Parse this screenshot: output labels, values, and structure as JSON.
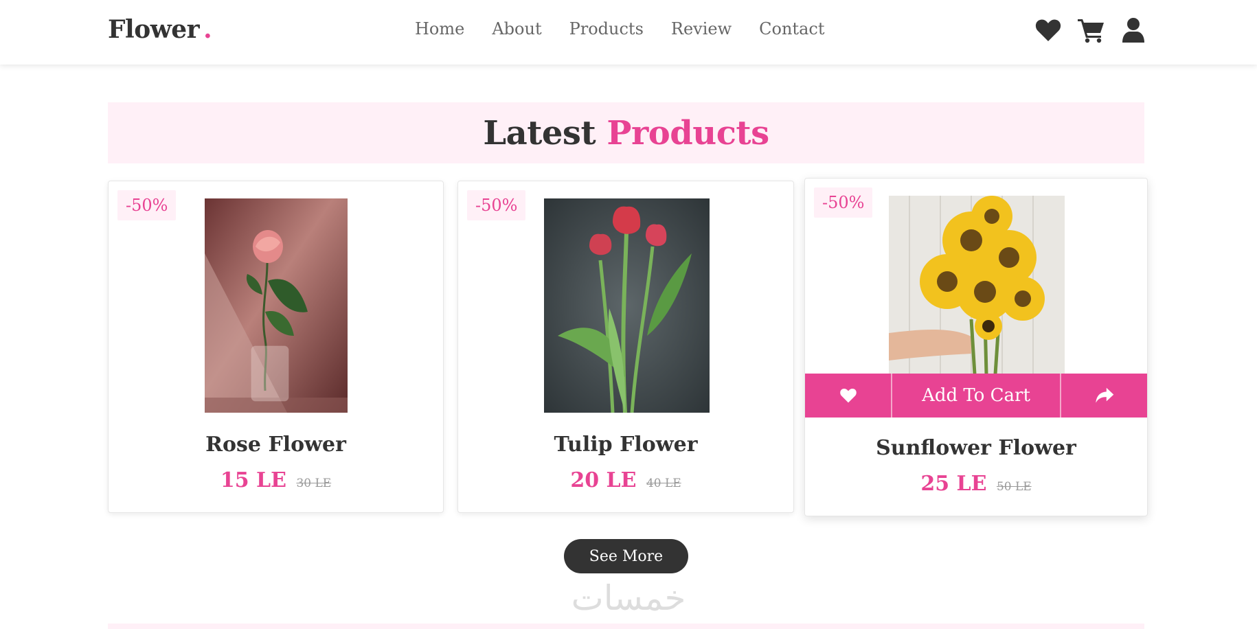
{
  "header": {
    "logo_text": "Flower",
    "logo_dot": ".",
    "nav": [
      "Home",
      "About",
      "Products",
      "Review",
      "Contact"
    ],
    "icons": [
      "heart-icon",
      "cart-icon",
      "user-icon"
    ]
  },
  "section": {
    "title_main": "Latest",
    "title_accent": "Products"
  },
  "products": [
    {
      "discount": "-50%",
      "name": "Rose Flower",
      "price": "15 LE",
      "old_price": "30 LE"
    },
    {
      "discount": "-50%",
      "name": "Tulip Flower",
      "price": "20 LE",
      "old_price": "40 LE"
    },
    {
      "discount": "-50%",
      "name": "Sunflower Flower",
      "price": "25 LE",
      "old_price": "50 LE",
      "actions": {
        "add_to_cart": "Add To Cart",
        "icons": [
          "heart-icon",
          "share-icon"
        ]
      }
    }
  ],
  "see_more_label": "See More",
  "watermark": "خمسات",
  "colors": {
    "accent": "#e84393",
    "dark": "#333333",
    "tint": "#fff0f7"
  }
}
